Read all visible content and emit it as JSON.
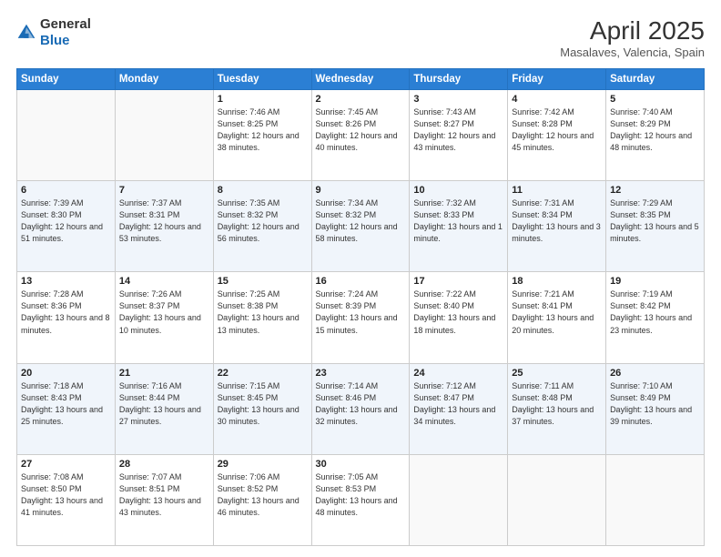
{
  "header": {
    "logo_general": "General",
    "logo_blue": "Blue",
    "month_title": "April 2025",
    "subtitle": "Masalaves, Valencia, Spain"
  },
  "days_of_week": [
    "Sunday",
    "Monday",
    "Tuesday",
    "Wednesday",
    "Thursday",
    "Friday",
    "Saturday"
  ],
  "weeks": [
    [
      {
        "day": "",
        "sunrise": "",
        "sunset": "",
        "daylight": ""
      },
      {
        "day": "",
        "sunrise": "",
        "sunset": "",
        "daylight": ""
      },
      {
        "day": "1",
        "sunrise": "Sunrise: 7:46 AM",
        "sunset": "Sunset: 8:25 PM",
        "daylight": "Daylight: 12 hours and 38 minutes."
      },
      {
        "day": "2",
        "sunrise": "Sunrise: 7:45 AM",
        "sunset": "Sunset: 8:26 PM",
        "daylight": "Daylight: 12 hours and 40 minutes."
      },
      {
        "day": "3",
        "sunrise": "Sunrise: 7:43 AM",
        "sunset": "Sunset: 8:27 PM",
        "daylight": "Daylight: 12 hours and 43 minutes."
      },
      {
        "day": "4",
        "sunrise": "Sunrise: 7:42 AM",
        "sunset": "Sunset: 8:28 PM",
        "daylight": "Daylight: 12 hours and 45 minutes."
      },
      {
        "day": "5",
        "sunrise": "Sunrise: 7:40 AM",
        "sunset": "Sunset: 8:29 PM",
        "daylight": "Daylight: 12 hours and 48 minutes."
      }
    ],
    [
      {
        "day": "6",
        "sunrise": "Sunrise: 7:39 AM",
        "sunset": "Sunset: 8:30 PM",
        "daylight": "Daylight: 12 hours and 51 minutes."
      },
      {
        "day": "7",
        "sunrise": "Sunrise: 7:37 AM",
        "sunset": "Sunset: 8:31 PM",
        "daylight": "Daylight: 12 hours and 53 minutes."
      },
      {
        "day": "8",
        "sunrise": "Sunrise: 7:35 AM",
        "sunset": "Sunset: 8:32 PM",
        "daylight": "Daylight: 12 hours and 56 minutes."
      },
      {
        "day": "9",
        "sunrise": "Sunrise: 7:34 AM",
        "sunset": "Sunset: 8:32 PM",
        "daylight": "Daylight: 12 hours and 58 minutes."
      },
      {
        "day": "10",
        "sunrise": "Sunrise: 7:32 AM",
        "sunset": "Sunset: 8:33 PM",
        "daylight": "Daylight: 13 hours and 1 minute."
      },
      {
        "day": "11",
        "sunrise": "Sunrise: 7:31 AM",
        "sunset": "Sunset: 8:34 PM",
        "daylight": "Daylight: 13 hours and 3 minutes."
      },
      {
        "day": "12",
        "sunrise": "Sunrise: 7:29 AM",
        "sunset": "Sunset: 8:35 PM",
        "daylight": "Daylight: 13 hours and 5 minutes."
      }
    ],
    [
      {
        "day": "13",
        "sunrise": "Sunrise: 7:28 AM",
        "sunset": "Sunset: 8:36 PM",
        "daylight": "Daylight: 13 hours and 8 minutes."
      },
      {
        "day": "14",
        "sunrise": "Sunrise: 7:26 AM",
        "sunset": "Sunset: 8:37 PM",
        "daylight": "Daylight: 13 hours and 10 minutes."
      },
      {
        "day": "15",
        "sunrise": "Sunrise: 7:25 AM",
        "sunset": "Sunset: 8:38 PM",
        "daylight": "Daylight: 13 hours and 13 minutes."
      },
      {
        "day": "16",
        "sunrise": "Sunrise: 7:24 AM",
        "sunset": "Sunset: 8:39 PM",
        "daylight": "Daylight: 13 hours and 15 minutes."
      },
      {
        "day": "17",
        "sunrise": "Sunrise: 7:22 AM",
        "sunset": "Sunset: 8:40 PM",
        "daylight": "Daylight: 13 hours and 18 minutes."
      },
      {
        "day": "18",
        "sunrise": "Sunrise: 7:21 AM",
        "sunset": "Sunset: 8:41 PM",
        "daylight": "Daylight: 13 hours and 20 minutes."
      },
      {
        "day": "19",
        "sunrise": "Sunrise: 7:19 AM",
        "sunset": "Sunset: 8:42 PM",
        "daylight": "Daylight: 13 hours and 23 minutes."
      }
    ],
    [
      {
        "day": "20",
        "sunrise": "Sunrise: 7:18 AM",
        "sunset": "Sunset: 8:43 PM",
        "daylight": "Daylight: 13 hours and 25 minutes."
      },
      {
        "day": "21",
        "sunrise": "Sunrise: 7:16 AM",
        "sunset": "Sunset: 8:44 PM",
        "daylight": "Daylight: 13 hours and 27 minutes."
      },
      {
        "day": "22",
        "sunrise": "Sunrise: 7:15 AM",
        "sunset": "Sunset: 8:45 PM",
        "daylight": "Daylight: 13 hours and 30 minutes."
      },
      {
        "day": "23",
        "sunrise": "Sunrise: 7:14 AM",
        "sunset": "Sunset: 8:46 PM",
        "daylight": "Daylight: 13 hours and 32 minutes."
      },
      {
        "day": "24",
        "sunrise": "Sunrise: 7:12 AM",
        "sunset": "Sunset: 8:47 PM",
        "daylight": "Daylight: 13 hours and 34 minutes."
      },
      {
        "day": "25",
        "sunrise": "Sunrise: 7:11 AM",
        "sunset": "Sunset: 8:48 PM",
        "daylight": "Daylight: 13 hours and 37 minutes."
      },
      {
        "day": "26",
        "sunrise": "Sunrise: 7:10 AM",
        "sunset": "Sunset: 8:49 PM",
        "daylight": "Daylight: 13 hours and 39 minutes."
      }
    ],
    [
      {
        "day": "27",
        "sunrise": "Sunrise: 7:08 AM",
        "sunset": "Sunset: 8:50 PM",
        "daylight": "Daylight: 13 hours and 41 minutes."
      },
      {
        "day": "28",
        "sunrise": "Sunrise: 7:07 AM",
        "sunset": "Sunset: 8:51 PM",
        "daylight": "Daylight: 13 hours and 43 minutes."
      },
      {
        "day": "29",
        "sunrise": "Sunrise: 7:06 AM",
        "sunset": "Sunset: 8:52 PM",
        "daylight": "Daylight: 13 hours and 46 minutes."
      },
      {
        "day": "30",
        "sunrise": "Sunrise: 7:05 AM",
        "sunset": "Sunset: 8:53 PM",
        "daylight": "Daylight: 13 hours and 48 minutes."
      },
      {
        "day": "",
        "sunrise": "",
        "sunset": "",
        "daylight": ""
      },
      {
        "day": "",
        "sunrise": "",
        "sunset": "",
        "daylight": ""
      },
      {
        "day": "",
        "sunrise": "",
        "sunset": "",
        "daylight": ""
      }
    ]
  ]
}
